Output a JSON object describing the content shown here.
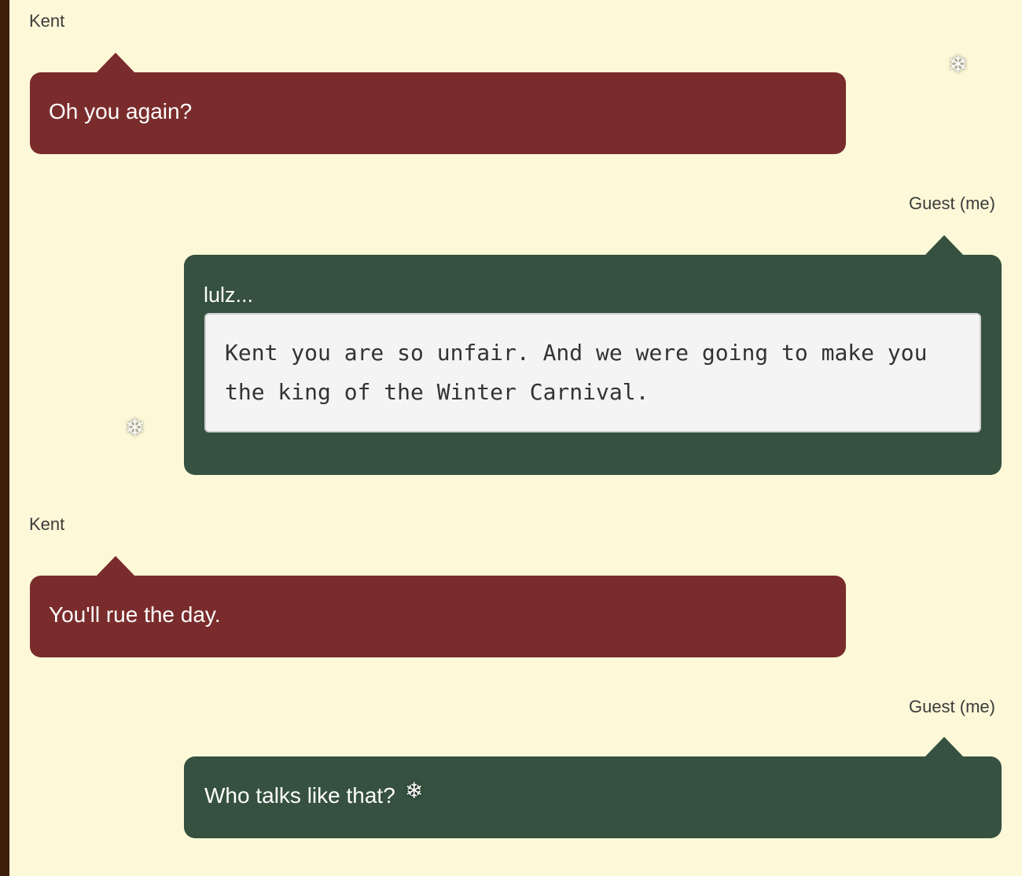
{
  "messages": [
    {
      "sender": "Kent",
      "text": "Oh you again?"
    },
    {
      "sender": "Guest (me)",
      "text": "lulz...",
      "code": "Kent you are so unfair. And we were going to make you the king of the Winter Carnival."
    },
    {
      "sender": "Kent",
      "text": "You'll rue the day."
    },
    {
      "sender": "Guest (me)",
      "text": "Who talks like that?"
    }
  ],
  "decorations": {
    "snowflake_glyph": "❄",
    "icon": "snowflake-icon"
  },
  "colors": {
    "background": "#fcf8d8",
    "rail": "#3e1e0a",
    "kent_bubble": "#7a2c2c",
    "guest_bubble": "#36513f",
    "code_background": "#f4f4f4"
  }
}
